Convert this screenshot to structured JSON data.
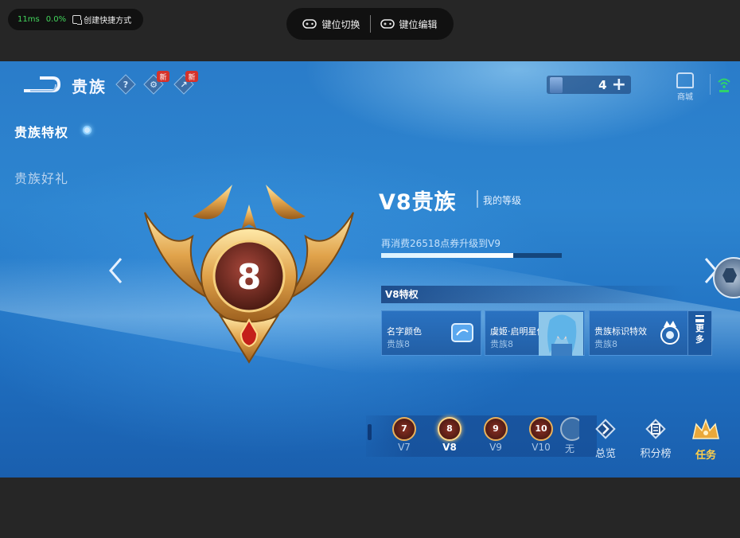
{
  "emulator": {
    "latency": "11ms",
    "loss": "0.0%",
    "shortcut_label": "创建快捷方式",
    "keymap_switch_label": "键位切换",
    "keymap_edit_label": "键位编辑"
  },
  "header": {
    "title": "贵族",
    "help_glyph": "?",
    "new_badge": "新",
    "currency_value": "4",
    "currency_add": "+",
    "shop_label": "商城"
  },
  "sidebar": {
    "items": [
      {
        "label": "贵族特权"
      },
      {
        "label": "贵族好礼"
      }
    ]
  },
  "emblem": {
    "level": "8"
  },
  "level_info": {
    "title": "V8贵族",
    "subtitle": "我的等级",
    "progress_text": "再消费26518点券升级到V9",
    "progress_fraction": 0.73
  },
  "privileges": {
    "header": "V8特权",
    "cards": [
      {
        "name": "名字颜色",
        "level": "贵族8"
      },
      {
        "name": "虞姬·启明星使",
        "level": "贵族8"
      },
      {
        "name": "贵族标识特效",
        "level": "贵族8"
      }
    ],
    "more_label_1": "更",
    "more_label_2": "多"
  },
  "levels": [
    {
      "num": "7",
      "label": "V7"
    },
    {
      "num": "8",
      "label": "V8"
    },
    {
      "num": "9",
      "label": "V9"
    },
    {
      "num": "10",
      "label": "V10"
    },
    {
      "num": "",
      "label": "无"
    }
  ],
  "bottom_nav": {
    "overview": "总览",
    "ranking": "积分榜",
    "task": "任务"
  },
  "colors": {
    "accent_gold": "#e8b15c",
    "task_gold": "#ffcf4a",
    "badge_red": "#d5322b",
    "green": "#43d65c"
  }
}
